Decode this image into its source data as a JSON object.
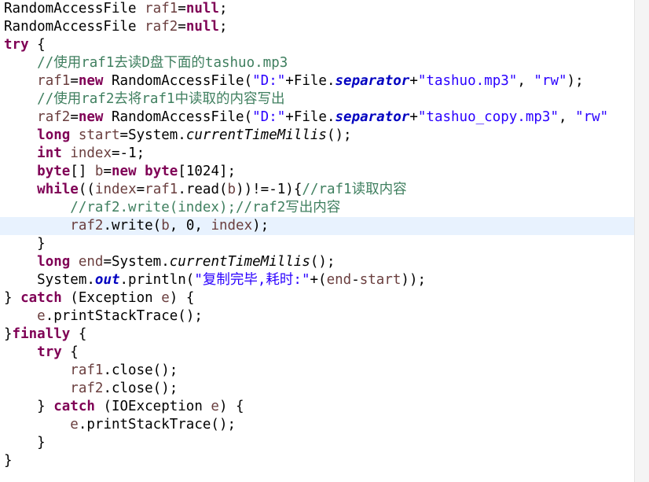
{
  "editor": {
    "current_line_index": 12,
    "lines": [
      [
        {
          "t": "RandomAccessFile ",
          "c": ""
        },
        {
          "t": "raf1",
          "c": "var"
        },
        {
          "t": "=",
          "c": ""
        },
        {
          "t": "null",
          "c": "kw"
        },
        {
          "t": ";",
          "c": ""
        }
      ],
      [
        {
          "t": "RandomAccessFile ",
          "c": ""
        },
        {
          "t": "raf2",
          "c": "var"
        },
        {
          "t": "=",
          "c": ""
        },
        {
          "t": "null",
          "c": "kw"
        },
        {
          "t": ";",
          "c": ""
        }
      ],
      [
        {
          "t": "try",
          "c": "kw"
        },
        {
          "t": " {",
          "c": ""
        }
      ],
      [
        {
          "t": "    ",
          "c": ""
        },
        {
          "t": "//使用raf1去读D盘下面的tashuo.mp3",
          "c": "cmt"
        }
      ],
      [
        {
          "t": "    ",
          "c": ""
        },
        {
          "t": "raf1",
          "c": "var"
        },
        {
          "t": "=",
          "c": ""
        },
        {
          "t": "new",
          "c": "kw"
        },
        {
          "t": " RandomAccessFile(",
          "c": ""
        },
        {
          "t": "\"D:\"",
          "c": "str"
        },
        {
          "t": "+File.",
          "c": ""
        },
        {
          "t": "separator",
          "c": "fld"
        },
        {
          "t": "+",
          "c": ""
        },
        {
          "t": "\"tashuo.mp3\"",
          "c": "str"
        },
        {
          "t": ", ",
          "c": ""
        },
        {
          "t": "\"rw\"",
          "c": "str"
        },
        {
          "t": ");",
          "c": ""
        }
      ],
      [
        {
          "t": "    ",
          "c": ""
        },
        {
          "t": "//使用raf2去将raf1中读取的内容写出",
          "c": "cmt"
        }
      ],
      [
        {
          "t": "    ",
          "c": ""
        },
        {
          "t": "raf2",
          "c": "var"
        },
        {
          "t": "=",
          "c": ""
        },
        {
          "t": "new",
          "c": "kw"
        },
        {
          "t": " RandomAccessFile(",
          "c": ""
        },
        {
          "t": "\"D:\"",
          "c": "str"
        },
        {
          "t": "+File.",
          "c": ""
        },
        {
          "t": "separator",
          "c": "fld"
        },
        {
          "t": "+",
          "c": ""
        },
        {
          "t": "\"tashuo_copy.mp3\"",
          "c": "str"
        },
        {
          "t": ", ",
          "c": ""
        },
        {
          "t": "\"rw\"",
          "c": "str"
        }
      ],
      [
        {
          "t": "    ",
          "c": ""
        },
        {
          "t": "long",
          "c": "kw"
        },
        {
          "t": " ",
          "c": ""
        },
        {
          "t": "start",
          "c": "var"
        },
        {
          "t": "=System.",
          "c": ""
        },
        {
          "t": "currentTimeMillis",
          "c": "mth"
        },
        {
          "t": "();",
          "c": ""
        }
      ],
      [
        {
          "t": "    ",
          "c": ""
        },
        {
          "t": "int",
          "c": "kw"
        },
        {
          "t": " ",
          "c": ""
        },
        {
          "t": "index",
          "c": "var"
        },
        {
          "t": "=-1;",
          "c": ""
        }
      ],
      [
        {
          "t": "    ",
          "c": ""
        },
        {
          "t": "byte",
          "c": "kw"
        },
        {
          "t": "[] ",
          "c": ""
        },
        {
          "t": "b",
          "c": "var"
        },
        {
          "t": "=",
          "c": ""
        },
        {
          "t": "new",
          "c": "kw"
        },
        {
          "t": " ",
          "c": ""
        },
        {
          "t": "byte",
          "c": "kw"
        },
        {
          "t": "[1024];",
          "c": ""
        }
      ],
      [
        {
          "t": "    ",
          "c": ""
        },
        {
          "t": "while",
          "c": "kw"
        },
        {
          "t": "((",
          "c": ""
        },
        {
          "t": "index",
          "c": "var"
        },
        {
          "t": "=",
          "c": ""
        },
        {
          "t": "raf1",
          "c": "var"
        },
        {
          "t": ".read(",
          "c": ""
        },
        {
          "t": "b",
          "c": "var"
        },
        {
          "t": "))!=-1){",
          "c": ""
        },
        {
          "t": "//raf1读取内容",
          "c": "cmt"
        }
      ],
      [
        {
          "t": "        ",
          "c": ""
        },
        {
          "t": "//raf2.write(index);//raf2写出内容",
          "c": "cmt"
        }
      ],
      [
        {
          "t": "        ",
          "c": ""
        },
        {
          "t": "raf2",
          "c": "var"
        },
        {
          "t": ".write(",
          "c": ""
        },
        {
          "t": "b",
          "c": "var"
        },
        {
          "t": ", 0, ",
          "c": ""
        },
        {
          "t": "index",
          "c": "var"
        },
        {
          "t": ");",
          "c": ""
        }
      ],
      [
        {
          "t": "    }",
          "c": ""
        }
      ],
      [
        {
          "t": "    ",
          "c": ""
        },
        {
          "t": "long",
          "c": "kw"
        },
        {
          "t": " ",
          "c": ""
        },
        {
          "t": "end",
          "c": "var"
        },
        {
          "t": "=System.",
          "c": ""
        },
        {
          "t": "currentTimeMillis",
          "c": "mth"
        },
        {
          "t": "();",
          "c": ""
        }
      ],
      [
        {
          "t": "    System.",
          "c": ""
        },
        {
          "t": "out",
          "c": "fld"
        },
        {
          "t": ".println(",
          "c": ""
        },
        {
          "t": "\"复制完毕,耗时:\"",
          "c": "str"
        },
        {
          "t": "+(",
          "c": ""
        },
        {
          "t": "end",
          "c": "var"
        },
        {
          "t": "-",
          "c": ""
        },
        {
          "t": "start",
          "c": "var"
        },
        {
          "t": "));",
          "c": ""
        }
      ],
      [
        {
          "t": "} ",
          "c": ""
        },
        {
          "t": "catch",
          "c": "kw"
        },
        {
          "t": " (Exception ",
          "c": ""
        },
        {
          "t": "e",
          "c": "var"
        },
        {
          "t": ") {",
          "c": ""
        }
      ],
      [
        {
          "t": "    ",
          "c": ""
        },
        {
          "t": "e",
          "c": "var"
        },
        {
          "t": ".printStackTrace();",
          "c": ""
        }
      ],
      [
        {
          "t": "}",
          "c": ""
        },
        {
          "t": "finally",
          "c": "kw"
        },
        {
          "t": " {",
          "c": ""
        }
      ],
      [
        {
          "t": "    ",
          "c": ""
        },
        {
          "t": "try",
          "c": "kw"
        },
        {
          "t": " {",
          "c": ""
        }
      ],
      [
        {
          "t": "        ",
          "c": ""
        },
        {
          "t": "raf1",
          "c": "var"
        },
        {
          "t": ".close();",
          "c": ""
        }
      ],
      [
        {
          "t": "        ",
          "c": ""
        },
        {
          "t": "raf2",
          "c": "var"
        },
        {
          "t": ".close();",
          "c": ""
        }
      ],
      [
        {
          "t": "    } ",
          "c": ""
        },
        {
          "t": "catch",
          "c": "kw"
        },
        {
          "t": " (IOException ",
          "c": ""
        },
        {
          "t": "e",
          "c": "var"
        },
        {
          "t": ") {",
          "c": ""
        }
      ],
      [
        {
          "t": "        ",
          "c": ""
        },
        {
          "t": "e",
          "c": "var"
        },
        {
          "t": ".printStackTrace();",
          "c": ""
        }
      ],
      [
        {
          "t": "    }",
          "c": ""
        }
      ],
      [
        {
          "t": "}",
          "c": ""
        }
      ]
    ]
  }
}
